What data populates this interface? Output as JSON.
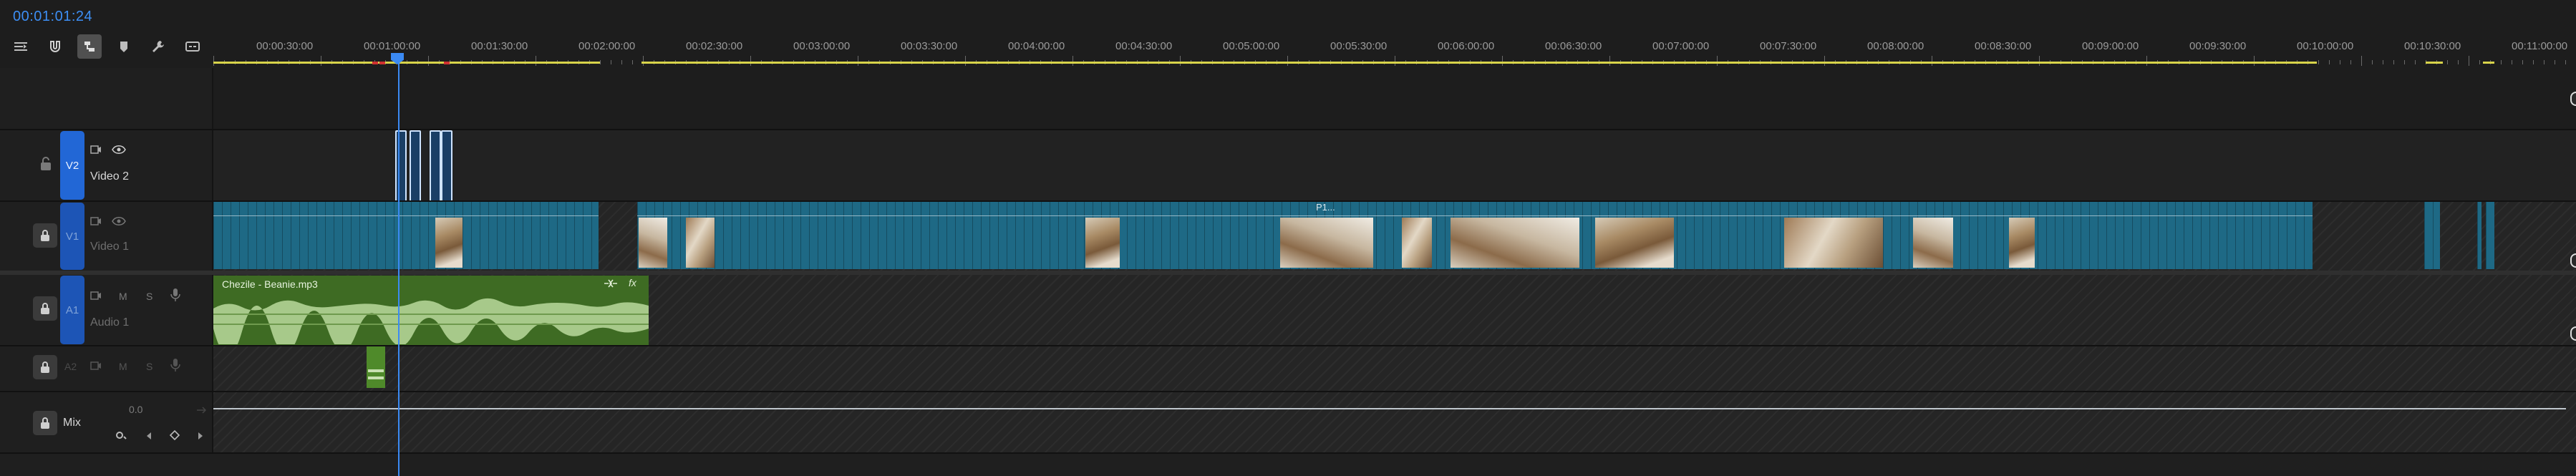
{
  "timecode": "00:01:01:24",
  "toolbar": {
    "icons": [
      "sequence-settings-icon",
      "snap-magnet-icon",
      "linked-selection-icon",
      "add-marker-icon",
      "wrench-settings-icon",
      "captions-icon"
    ]
  },
  "ruler": {
    "labels": [
      "00:00:30:00",
      "00:01:00:00",
      "00:01:30:00",
      "00:02:00:00",
      "00:02:30:00",
      "00:03:00:00",
      "00:03:30:00",
      "00:04:00:00",
      "00:04:30:00",
      "00:05:00:00",
      "00:05:30:00",
      "00:06:00:00",
      "00:06:30:00",
      "00:07:00:00",
      "00:07:30:00",
      "00:08:00:00",
      "00:08:30:00",
      "00:09:00:00",
      "00:09:30:00",
      "00:10:00:00",
      "00:10:30:00",
      "00:11:00:00"
    ]
  },
  "tracks": {
    "v2": {
      "target": "V2",
      "name": "Video 2"
    },
    "v1": {
      "target": "V1",
      "name": "Video 1"
    },
    "a1": {
      "target": "A1",
      "name": "Audio 1",
      "m": "M",
      "s": "S"
    },
    "a2": {
      "target": "A2",
      "m": "M",
      "s": "S"
    },
    "mix": {
      "name": "Mix",
      "value": "0.0"
    }
  },
  "clips": {
    "audio_label": "Chezile - Beanie.mp3",
    "audio_fx": "fx",
    "v1_label": "P1..."
  },
  "colors": {
    "accent": "#3b8af3",
    "video_clip": "#1e6985",
    "audio_clip": "#3e6b23",
    "work_area": "#d8d34a",
    "marker": "#cf3030"
  }
}
